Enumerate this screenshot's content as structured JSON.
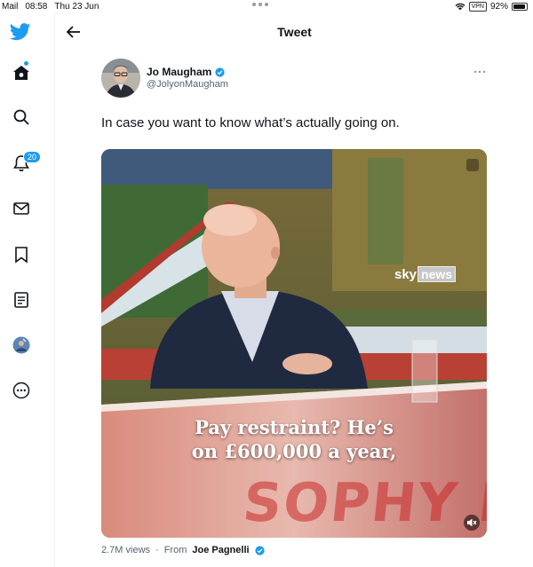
{
  "status_bar": {
    "app": "Mail",
    "time": "08:58",
    "date": "Thu 23 Jun",
    "vpn": "VPN",
    "battery": "92%"
  },
  "sidebar": {
    "items": [
      {
        "icon": "twitter-logo-icon"
      },
      {
        "icon": "home-icon"
      },
      {
        "icon": "search-icon"
      },
      {
        "icon": "notifications-icon",
        "badge": "20"
      },
      {
        "icon": "messages-icon"
      },
      {
        "icon": "bookmark-icon"
      },
      {
        "icon": "lists-icon"
      },
      {
        "icon": "profile-avatar-icon"
      },
      {
        "icon": "more-options-icon"
      }
    ]
  },
  "header": {
    "title": "Tweet"
  },
  "tweet": {
    "author_name": "Jo Maugham",
    "author_handle": "@JolyonMaugham",
    "text": "In case you want to know what’s actually going on.",
    "media": {
      "caption_line1": "Pay restraint? He’s",
      "caption_line2": "on £600,000 a year,",
      "broadcaster_sky": "sky",
      "broadcaster_news": "news",
      "watermark": "SOPHY RID"
    },
    "views": "2.7M views",
    "from_label": "From",
    "from_name": "Joe Pagnelli"
  },
  "colors": {
    "accent": "#1d9bf0",
    "text": "#0f1419",
    "muted": "#536471"
  }
}
